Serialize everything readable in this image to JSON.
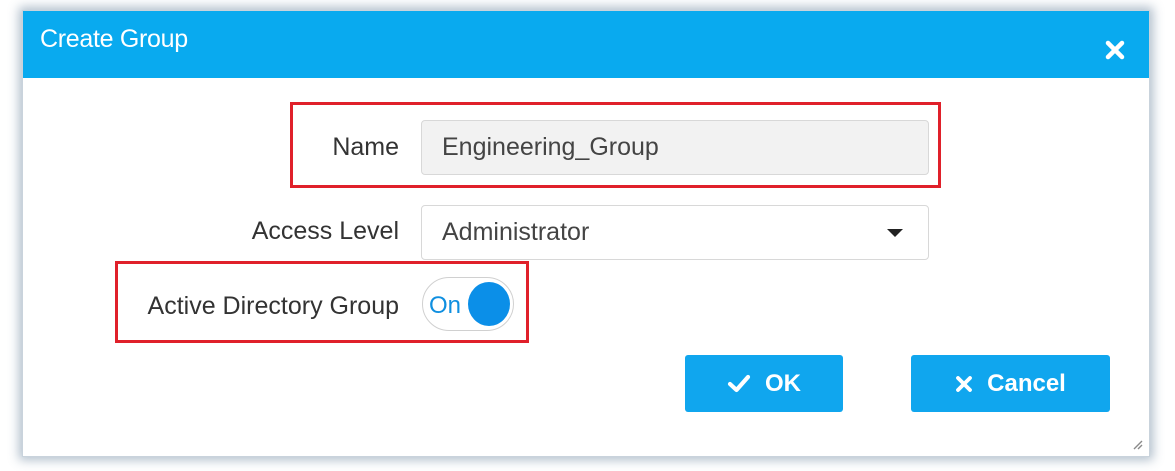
{
  "dialog": {
    "title": "Create Group",
    "close_icon": "close-icon"
  },
  "form": {
    "name_label": "Name",
    "name_value": "Engineering_Group",
    "access_level_label": "Access Level",
    "access_level_value": "Administrator",
    "ad_group_label": "Active Directory Group",
    "ad_group_toggle_text": "On",
    "ad_group_enabled": true
  },
  "buttons": {
    "ok_label": "OK",
    "ok_icon": "checkmark-icon",
    "cancel_label": "Cancel",
    "cancel_icon": "x-icon"
  },
  "colors": {
    "header": "#09aaef",
    "button": "#10a6ee",
    "highlight": "#e0202a",
    "toggle_knob": "#0b8fe8"
  }
}
